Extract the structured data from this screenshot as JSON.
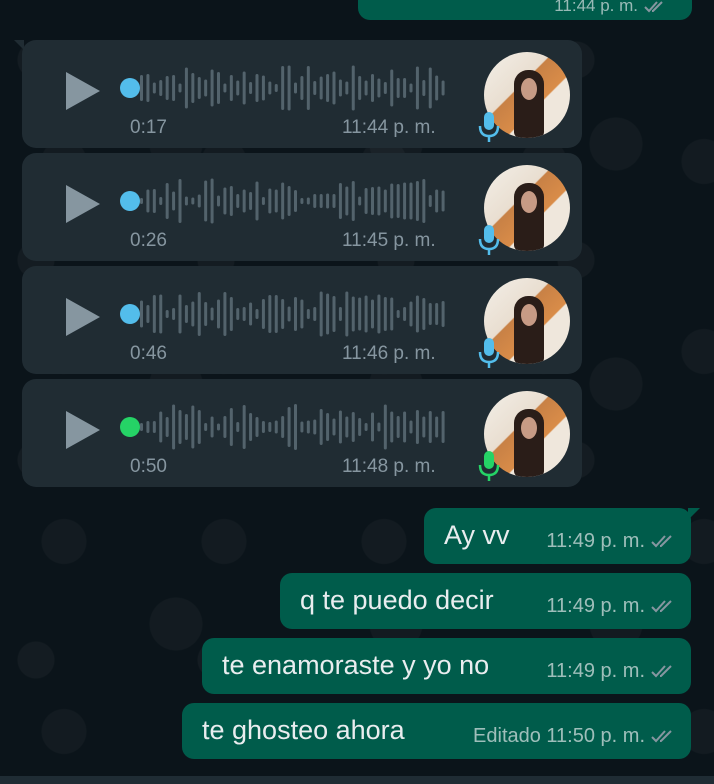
{
  "top_message": {
    "time": "11:44 p. m."
  },
  "audio_messages": [
    {
      "duration": "0:17",
      "time": "11:44 p. m.",
      "status": "unplayed",
      "dot_color": "#53bdeb"
    },
    {
      "duration": "0:26",
      "time": "11:45 p. m.",
      "status": "unplayed",
      "dot_color": "#53bdeb"
    },
    {
      "duration": "0:46",
      "time": "11:46 p. m.",
      "status": "unplayed",
      "dot_color": "#53bdeb"
    },
    {
      "duration": "0:50",
      "time": "11:48 p. m.",
      "status": "unplayed",
      "dot_color": "#25d366"
    }
  ],
  "mic_colors": [
    "#53bdeb",
    "#53bdeb",
    "#53bdeb",
    "#25d366"
  ],
  "outgoing_messages": [
    {
      "text": "Ay vv",
      "meta": "11:49 p. m."
    },
    {
      "text": "q te puedo decir",
      "meta": "11:49 p. m."
    },
    {
      "text": "te enamoraste y yo no",
      "meta": "11:49 p. m."
    },
    {
      "text": "te ghosteo ahora",
      "meta": "Editado 11:50 p. m."
    }
  ],
  "icons": {
    "play": "play-icon",
    "mic": "microphone-icon",
    "read": "double-check-icon"
  },
  "colors": {
    "background": "#0b141a",
    "incoming_bubble": "#202c33",
    "outgoing_bubble": "#005c4b",
    "meta_text": "#8696a0"
  }
}
